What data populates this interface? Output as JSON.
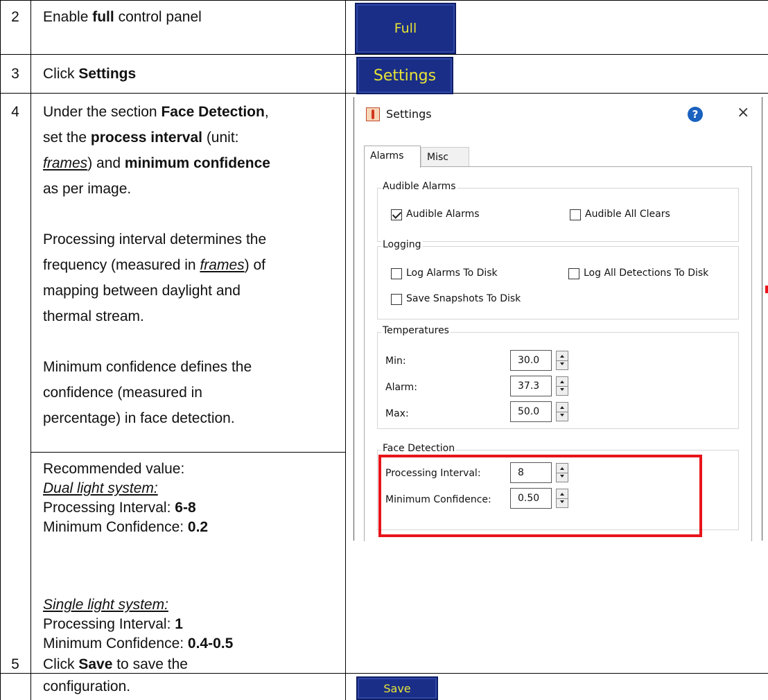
{
  "rows": [
    {
      "num": "2",
      "text_before": "Enable ",
      "bold": "full",
      "text_after": " control panel",
      "button": "Full"
    },
    {
      "num": "3",
      "text_before": "Click ",
      "bold": "Settings",
      "button": "Settings"
    },
    {
      "num": "4",
      "p1": {
        "l1_a": "Under the section ",
        "l1_b": "Face Detection",
        "l1_c": ",",
        "l2_a": "set the ",
        "l2_b": "process interval",
        "l2_c": " (unit:",
        "l3_a": "frames",
        "l3_b": ") and ",
        "l3_c": "minimum confidence",
        "l4": "as per image."
      },
      "p2": {
        "l1": "Processing interval determines the",
        "l2_a": "frequency (measured in ",
        "l2_b": "frames",
        "l2_c": ") of",
        "l3": "mapping between daylight and",
        "l4": "thermal stream."
      },
      "p3": {
        "l1": "Minimum confidence defines the",
        "l2": "confidence (measured in",
        "l3": "percentage) in face detection."
      },
      "recommended": {
        "heading": "Recommended value:",
        "dual_heading": "Dual light system:",
        "dual_pi_label": "Processing Interval: ",
        "dual_pi_value": "6-8",
        "dual_mc_label": "Minimum Confidence: ",
        "dual_mc_value": "0.2",
        "single_heading": "Single light system:",
        "single_pi_label": "Processing Interval: ",
        "single_pi_value": "1",
        "single_mc_label": "Minimum Confidence: ",
        "single_mc_value": "0.4-0.5"
      }
    },
    {
      "num": "5",
      "text_before": "Click ",
      "bold": "Save",
      "text_after": " to save the",
      "line2": "configuration.",
      "button": "Save"
    }
  ],
  "dialog": {
    "title": "Settings",
    "help": "?",
    "close": "×",
    "tabs": [
      "Alarms",
      "Misc"
    ],
    "audible_group": "Audible Alarms",
    "audible_alarms": "Audible Alarms",
    "audible_all_clears": "Audible All Clears",
    "logging_group": "Logging",
    "log_alarms": "Log Alarms To Disk",
    "log_all_detections": "Log All Detections To Disk",
    "save_snapshots": "Save Snapshots To Disk",
    "temps_group": "Temperatures",
    "min_label": "Min:",
    "min_value": "30.0",
    "alarm_label": "Alarm:",
    "alarm_value": "37.3",
    "max_label": "Max:",
    "max_value": "50.0",
    "face_group": "Face Detection",
    "pi_label": "Processing Interval:",
    "pi_value": "8",
    "mc_label": "Minimum Confidence:",
    "mc_value": "0.50"
  },
  "colors": {
    "button_bg": "#1a2e88",
    "button_text": "#e8e436",
    "highlight": "#e8141a"
  }
}
